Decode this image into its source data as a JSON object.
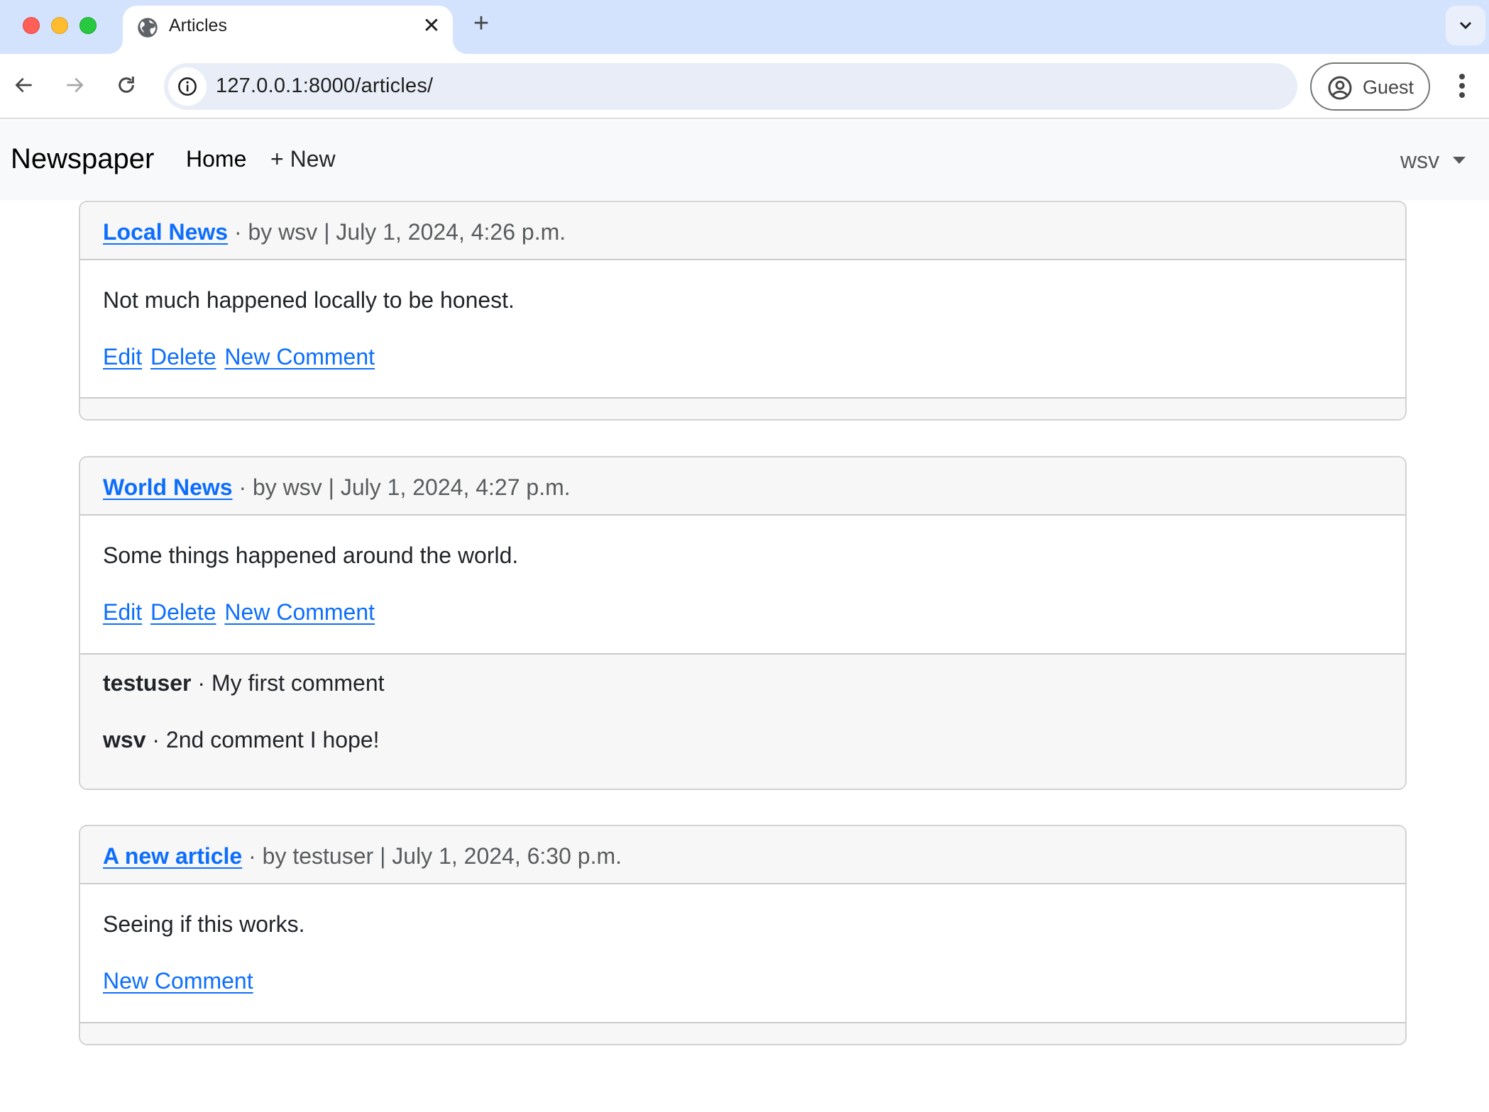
{
  "browser": {
    "tab_title": "Articles",
    "tab_icon": "globe-icon",
    "close_tab_symbol": "✕",
    "new_tab_symbol": "+",
    "url": "127.0.0.1:8000/articles/",
    "profile_label": "Guest"
  },
  "navbar": {
    "brand": "Newspaper",
    "links": [
      {
        "label": "Home"
      },
      {
        "label": "+ New"
      }
    ],
    "user_menu": "wsv"
  },
  "articles": [
    {
      "title": "Local News",
      "meta": " · by wsv | July 1, 2024, 4:26 p.m.",
      "body": "Not much happened locally to be honest.",
      "actions": [
        "Edit",
        "Delete",
        "New Comment"
      ],
      "comments": []
    },
    {
      "title": "World News",
      "meta": " · by wsv | July 1, 2024, 4:27 p.m.",
      "body": "Some things happened around the world.",
      "actions": [
        "Edit",
        "Delete",
        "New Comment"
      ],
      "comments": [
        {
          "author": "testuser",
          "text": " · My first comment"
        },
        {
          "author": "wsv",
          "text": " · 2nd comment I hope!"
        }
      ]
    },
    {
      "title": "A new article",
      "meta": " · by testuser | July 1, 2024, 6:30 p.m.",
      "body": "Seeing if this works.",
      "actions": [
        "New Comment"
      ],
      "comments": []
    }
  ],
  "colors": {
    "link": "#0d6efd",
    "tabbar": "#d3e3fd",
    "navbar_bg": "#f8f9fa",
    "card_header_bg": "#f7f7f7"
  }
}
